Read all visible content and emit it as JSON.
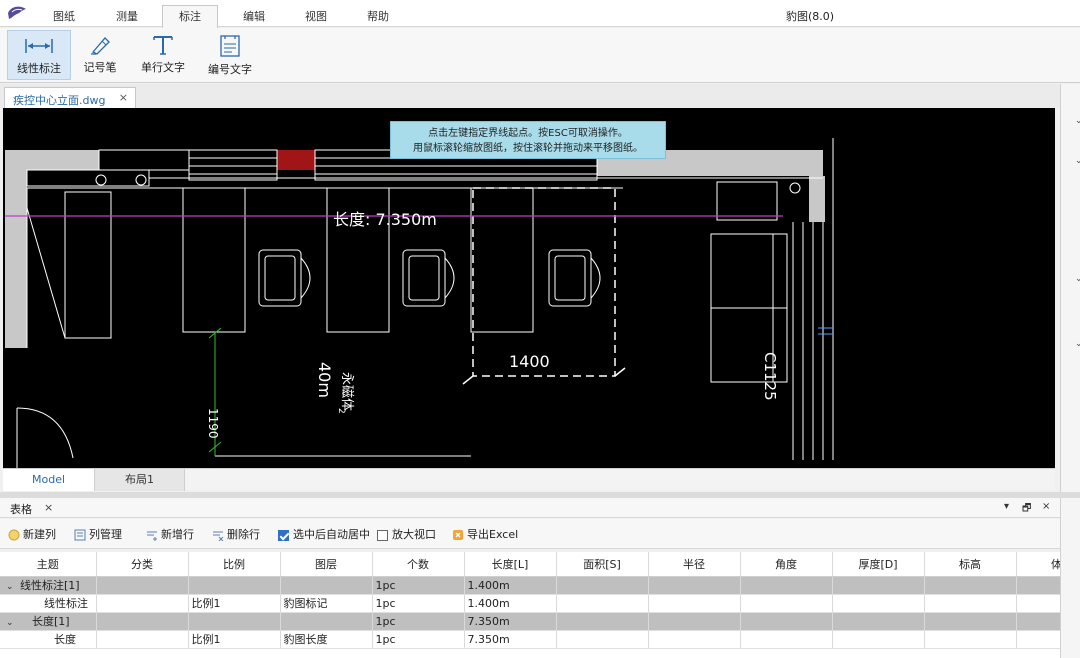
{
  "app": {
    "title": "豹图(8.0)"
  },
  "menu": {
    "tabs": [
      {
        "label": "图纸"
      },
      {
        "label": "测量"
      },
      {
        "label": "标注",
        "active": true
      },
      {
        "label": "编辑"
      },
      {
        "label": "视图"
      },
      {
        "label": "帮助"
      }
    ]
  },
  "ribbon": {
    "buttons": [
      {
        "label": "线性标注",
        "icon": "linear-dimension-icon",
        "active": true
      },
      {
        "label": "记号笔",
        "icon": "marker-pen-icon"
      },
      {
        "label": "单行文字",
        "icon": "text-icon"
      },
      {
        "label": "编号文字",
        "icon": "numbered-text-icon"
      }
    ]
  },
  "document": {
    "tab": "疾控中心立面.dwg",
    "close": "×"
  },
  "tooltip": {
    "line1": "点击左键指定界线起点。按ESC可取消操作。",
    "line2": "用鼠标滚轮缩放图纸，按住滚轮并拖动来平移图纸。"
  },
  "drawing": {
    "dimension_label": "长度: 7.350m",
    "dim_1400": "1400",
    "dim_1190": "1190",
    "text_40m": "40m",
    "text_c1125": "C1125",
    "text_vertical": "永磁体",
    "text_small": "2",
    "colors": {
      "background": "#000000",
      "wall": "#c8c8c8",
      "line": "#ffffff",
      "dimension": "#c040c0",
      "accent": "#cc2222",
      "green": "#2fbf2f"
    }
  },
  "layout": {
    "tabs": [
      {
        "label": "Model",
        "active": true
      },
      {
        "label": "布局1"
      }
    ]
  },
  "panel": {
    "title": "表格",
    "close": "×",
    "controls": {
      "pin": "▾",
      "restore": "🗗",
      "close": "×"
    },
    "toolbar": {
      "new_column": "新建列",
      "column_manage": "列管理",
      "new_row": "新增行",
      "delete_row": "删除行",
      "auto_center": "选中后自动居中",
      "auto_center_checked": true,
      "zoom_view": "放大视口",
      "zoom_view_checked": false,
      "export_excel": "导出Excel"
    },
    "columns": [
      "主题",
      "分类",
      "比例",
      "图层",
      "个数",
      "长度[L]",
      "面积[S]",
      "半径",
      "角度",
      "厚度[D]",
      "标高",
      "体积"
    ],
    "rows": [
      {
        "group": true,
        "cells": [
          "线性标注[1]",
          "",
          "",
          "",
          "1pc",
          "1.400m",
          "",
          "",
          "",
          "",
          "",
          ""
        ]
      },
      {
        "group": false,
        "cells": [
          "线性标注",
          "",
          "比例1",
          "豹图标记",
          "1pc",
          "1.400m",
          "",
          "",
          "",
          "",
          "",
          ""
        ]
      },
      {
        "group": true,
        "cells": [
          "长度[1]",
          "",
          "",
          "",
          "1pc",
          "7.350m",
          "",
          "",
          "",
          "",
          "",
          ""
        ]
      },
      {
        "group": false,
        "cells": [
          "长度",
          "",
          "比例1",
          "豹图长度",
          "1pc",
          "7.350m",
          "",
          "",
          "",
          "",
          "",
          ""
        ]
      }
    ],
    "group_caret": "⌄"
  }
}
